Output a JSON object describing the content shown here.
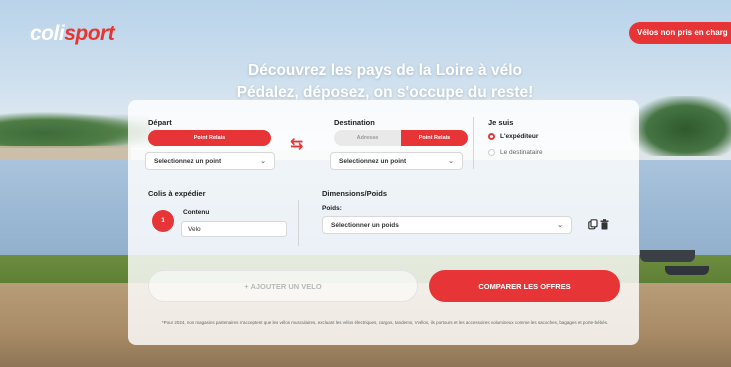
{
  "brand": {
    "logo_text_a": "coli",
    "logo_text_b": "sport",
    "accent": "#e73537"
  },
  "header": {
    "pill_label": "Vélos non pris en charg"
  },
  "hero": {
    "line1": "Découvrez les pays de la Loire à vélo",
    "line2": "Pédalez, déposez, on s'occupe du reste!"
  },
  "form": {
    "depart": {
      "label": "Départ",
      "toggle_active": "Point Relais",
      "select_value": "Selectionnez un point"
    },
    "destination": {
      "label": "Destination",
      "toggle_left": "Adresse",
      "toggle_right": "Point Relais",
      "select_value": "Selectionnez un point"
    },
    "je_suis": {
      "label": "Je suis",
      "option_selected": "L'expéditeur",
      "option_other": "Le destinataire"
    },
    "colis": {
      "label": "Colis à expédier",
      "badge": "1",
      "contenu_label": "Contenu",
      "contenu_value": "Velo"
    },
    "dimensions": {
      "label": "Dimensions/Poids",
      "poids_label": "Poids:",
      "poids_select": "Sélectionner un poids"
    },
    "icons": [
      "copy-icon",
      "trash-icon"
    ],
    "buttons": {
      "add_bike": "+ AJOUTER UN VELO",
      "compare": "COMPARER LES OFFRES"
    },
    "footnote": "*Pour 2024, nos magasins partenaires n'acceptent que les vélos musculaires, excluant les vélos électriques, cargos, tandems, Vvélos, ils portours et les accessoires volumineux comme les sacoches, bagages et porte-bébés."
  }
}
